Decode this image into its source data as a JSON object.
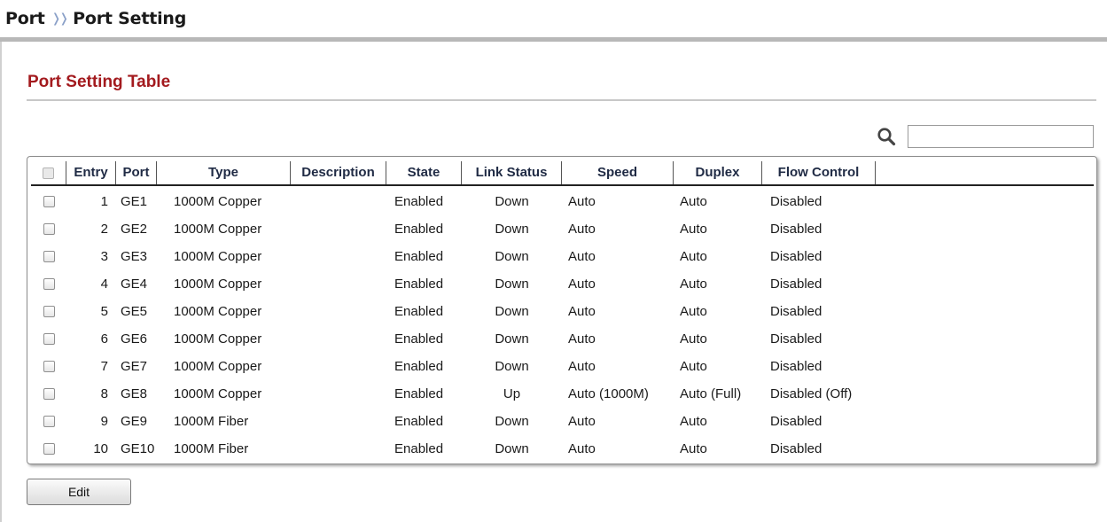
{
  "breadcrumb": {
    "section": "Port",
    "separator": "❭❭",
    "page": "Port Setting"
  },
  "table_title": "Port Setting Table",
  "search": {
    "icon": "search-icon",
    "value": "",
    "placeholder": ""
  },
  "columns": [
    "Entry",
    "Port",
    "Type",
    "Description",
    "State",
    "Link Status",
    "Speed",
    "Duplex",
    "Flow Control"
  ],
  "rows": [
    {
      "entry": "1",
      "port": "GE1",
      "type": "1000M Copper",
      "description": "",
      "state": "Enabled",
      "link_status": "Down",
      "speed": "Auto",
      "duplex": "Auto",
      "flow_control": "Disabled"
    },
    {
      "entry": "2",
      "port": "GE2",
      "type": "1000M Copper",
      "description": "",
      "state": "Enabled",
      "link_status": "Down",
      "speed": "Auto",
      "duplex": "Auto",
      "flow_control": "Disabled"
    },
    {
      "entry": "3",
      "port": "GE3",
      "type": "1000M Copper",
      "description": "",
      "state": "Enabled",
      "link_status": "Down",
      "speed": "Auto",
      "duplex": "Auto",
      "flow_control": "Disabled"
    },
    {
      "entry": "4",
      "port": "GE4",
      "type": "1000M Copper",
      "description": "",
      "state": "Enabled",
      "link_status": "Down",
      "speed": "Auto",
      "duplex": "Auto",
      "flow_control": "Disabled"
    },
    {
      "entry": "5",
      "port": "GE5",
      "type": "1000M Copper",
      "description": "",
      "state": "Enabled",
      "link_status": "Down",
      "speed": "Auto",
      "duplex": "Auto",
      "flow_control": "Disabled"
    },
    {
      "entry": "6",
      "port": "GE6",
      "type": "1000M Copper",
      "description": "",
      "state": "Enabled",
      "link_status": "Down",
      "speed": "Auto",
      "duplex": "Auto",
      "flow_control": "Disabled"
    },
    {
      "entry": "7",
      "port": "GE7",
      "type": "1000M Copper",
      "description": "",
      "state": "Enabled",
      "link_status": "Down",
      "speed": "Auto",
      "duplex": "Auto",
      "flow_control": "Disabled"
    },
    {
      "entry": "8",
      "port": "GE8",
      "type": "1000M Copper",
      "description": "",
      "state": "Enabled",
      "link_status": "Up",
      "speed": "Auto (1000M)",
      "duplex": "Auto (Full)",
      "flow_control": "Disabled (Off)"
    },
    {
      "entry": "9",
      "port": "GE9",
      "type": "1000M Fiber",
      "description": "",
      "state": "Enabled",
      "link_status": "Down",
      "speed": "Auto",
      "duplex": "Auto",
      "flow_control": "Disabled"
    },
    {
      "entry": "10",
      "port": "GE10",
      "type": "1000M Fiber",
      "description": "",
      "state": "Enabled",
      "link_status": "Down",
      "speed": "Auto",
      "duplex": "Auto",
      "flow_control": "Disabled"
    }
  ],
  "buttons": {
    "edit": "Edit"
  },
  "colors": {
    "title_red": "#a31a1e",
    "separator_blue": "#8aa0c8",
    "header_text": "#1f2a44"
  }
}
